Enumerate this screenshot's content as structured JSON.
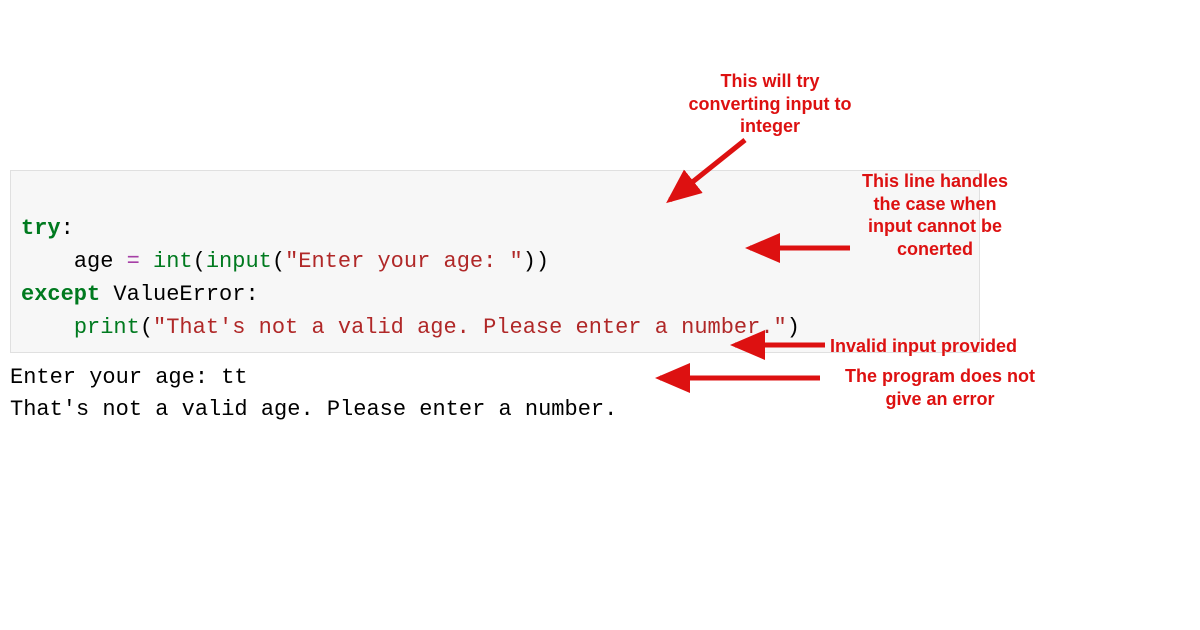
{
  "code": {
    "line1": {
      "kw_try": "try",
      "colon": ":"
    },
    "line2": {
      "indent": "    ",
      "var": "age",
      "eq": " = ",
      "int": "int",
      "lp1": "(",
      "input": "input",
      "lp2": "(",
      "str": "\"Enter your age: \"",
      "rp": "))"
    },
    "line3": {
      "kw_except": "except",
      "space": " ",
      "exc": "ValueError",
      "colon": ":"
    },
    "line4": {
      "indent": "    ",
      "print": "print",
      "lp": "(",
      "str": "\"That's not a valid age. Please enter a number.\"",
      "rp": ")"
    }
  },
  "output": {
    "line1": "Enter your age: tt",
    "line2": "That's not a valid age. Please enter a number."
  },
  "annotations": {
    "a1": "This will try\nconverting\ninput to integer",
    "a2": "This line\nhandles the\ncase when\ninput cannot be\nconerted",
    "a3": "Invalid input provided",
    "a4": "The program does not\ngive an error"
  },
  "colors": {
    "annotation": "#dd1111",
    "keyword": "#007a1f",
    "string": "#b02828",
    "operator": "#a63fa6",
    "codebg": "#f7f7f7"
  }
}
